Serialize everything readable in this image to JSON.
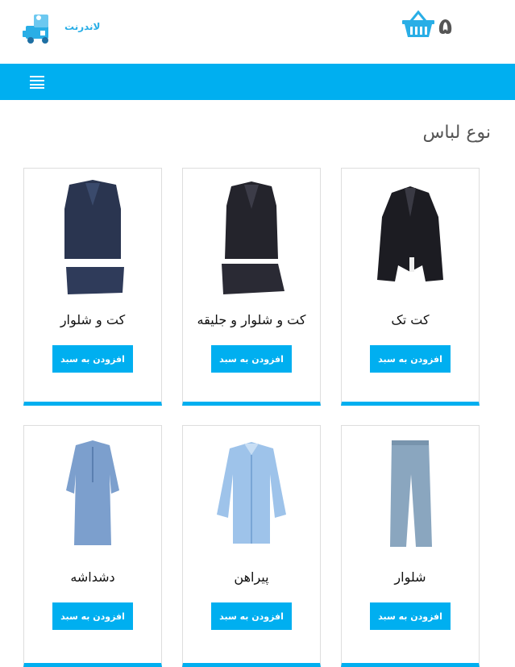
{
  "header": {
    "logo_text": "لاندرنت",
    "basket_count": "۵"
  },
  "page": {
    "section_title": "نوع لباس"
  },
  "products": [
    {
      "title": "کت تک",
      "button": "افزودن به سبد",
      "image": "jacket-icon"
    },
    {
      "title": "کت و شلوار و جلیقه",
      "button": "افزودن به سبد",
      "image": "three-piece-suit-icon"
    },
    {
      "title": "کت و شلوار",
      "button": "افزودن به سبد",
      "image": "suit-icon"
    },
    {
      "title": "شلوار",
      "button": "افزودن به سبد",
      "image": "trousers-icon"
    },
    {
      "title": "پیراهن",
      "button": "افزودن به سبد",
      "image": "shirt-icon"
    },
    {
      "title": "دشداشه",
      "button": "افزودن به سبد",
      "image": "dishdasha-icon"
    }
  ],
  "colors": {
    "accent": "#00aff0",
    "title_text": "#555555"
  }
}
